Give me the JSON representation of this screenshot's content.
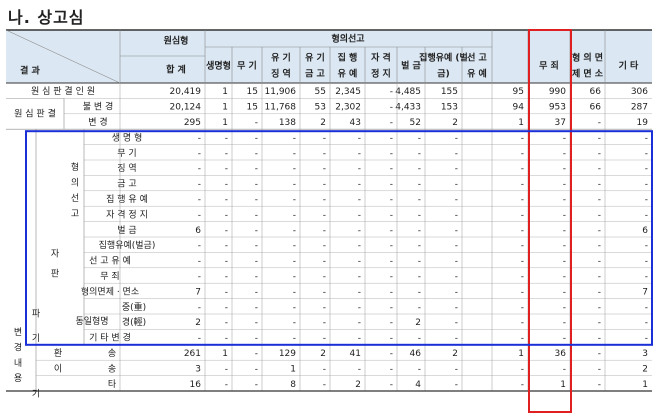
{
  "title": "나. 상고심",
  "header": {
    "result_label": "결 과",
    "original_sentence": "원심형",
    "total": "합 계",
    "sentence_group": "형의선고",
    "cols": [
      "생명형",
      "무 기",
      "유 기 징 역",
      "유 기 금 고",
      "집 행 유 예",
      "자 격 정 지",
      "벌 금",
      "집행유예 (벌 금)",
      "선 고 유 예",
      "무 죄",
      "형 의 면 제 면 소",
      "기 타"
    ]
  },
  "rows": [
    {
      "label": "원 심 판 결 인 원",
      "values": [
        "20,419",
        "1",
        "15",
        "11,906",
        "55",
        "2,345",
        "-",
        "4,485",
        "155",
        "95",
        "990",
        "66",
        "306"
      ]
    },
    {
      "label": "불 변 경",
      "values": [
        "20,124",
        "1",
        "15",
        "11,768",
        "53",
        "2,302",
        "-",
        "4,433",
        "153",
        "94",
        "953",
        "66",
        "287"
      ]
    },
    {
      "label": "변 경",
      "values": [
        "295",
        "1",
        "-",
        "138",
        "2",
        "43",
        "-",
        "52",
        "2",
        "1",
        "37",
        "-",
        "19"
      ]
    },
    {
      "label": "생 명 형",
      "values": [
        "-",
        "-",
        "-",
        "-",
        "-",
        "-",
        "-",
        "-",
        "-",
        "-",
        "-",
        "-",
        "-"
      ]
    },
    {
      "label": "무 기",
      "values": [
        "-",
        "-",
        "-",
        "-",
        "-",
        "-",
        "-",
        "-",
        "-",
        "-",
        "-",
        "-",
        "-"
      ]
    },
    {
      "label": "징 역",
      "values": [
        "-",
        "-",
        "-",
        "-",
        "-",
        "-",
        "-",
        "-",
        "-",
        "-",
        "-",
        "-",
        "-"
      ]
    },
    {
      "label": "금 고",
      "values": [
        "-",
        "-",
        "-",
        "-",
        "-",
        "-",
        "-",
        "-",
        "-",
        "-",
        "-",
        "-",
        "-"
      ]
    },
    {
      "label": "집 행 유 예",
      "values": [
        "-",
        "-",
        "-",
        "-",
        "-",
        "-",
        "-",
        "-",
        "-",
        "-",
        "-",
        "-",
        "-"
      ]
    },
    {
      "label": "자 격 정 지",
      "values": [
        "-",
        "-",
        "-",
        "-",
        "-",
        "-",
        "-",
        "-",
        "-",
        "-",
        "-",
        "-",
        "-"
      ]
    },
    {
      "label": "벌 금",
      "values": [
        "6",
        "-",
        "-",
        "-",
        "-",
        "-",
        "-",
        "-",
        "-",
        "-",
        "-",
        "-",
        "6"
      ]
    },
    {
      "label": "집행유예(벌금)",
      "values": [
        "-",
        "-",
        "-",
        "-",
        "-",
        "-",
        "-",
        "-",
        "-",
        "-",
        "-",
        "-",
        "-"
      ]
    },
    {
      "label": "선 고 유 예",
      "values": [
        "-",
        "-",
        "-",
        "-",
        "-",
        "-",
        "-",
        "-",
        "-",
        "-",
        "-",
        "-",
        "-"
      ]
    },
    {
      "label": "무 죄",
      "values": [
        "-",
        "-",
        "-",
        "-",
        "-",
        "-",
        "-",
        "-",
        "-",
        "-",
        "-",
        "-",
        "-"
      ]
    },
    {
      "label": "형의면제 · 면소",
      "values": [
        "7",
        "-",
        "-",
        "-",
        "-",
        "-",
        "-",
        "-",
        "-",
        "-",
        "-",
        "-",
        "7"
      ]
    },
    {
      "label": "중(重)",
      "values": [
        "-",
        "-",
        "-",
        "-",
        "-",
        "-",
        "-",
        "-",
        "-",
        "-",
        "-",
        "-",
        "-"
      ]
    },
    {
      "label": "경(輕)",
      "values": [
        "2",
        "-",
        "-",
        "-",
        "-",
        "-",
        "-",
        "2",
        "-",
        "-",
        "-",
        "-",
        "-"
      ]
    },
    {
      "label": "기 타 변 경",
      "values": [
        "-",
        "-",
        "-",
        "-",
        "-",
        "-",
        "-",
        "-",
        "-",
        "-",
        "-",
        "-",
        "-"
      ]
    },
    {
      "label": "환 송",
      "values": [
        "261",
        "1",
        "-",
        "129",
        "2",
        "41",
        "-",
        "46",
        "2",
        "1",
        "36",
        "-",
        "3"
      ]
    },
    {
      "label": "이 송",
      "values": [
        "3",
        "-",
        "-",
        "1",
        "-",
        "-",
        "-",
        "-",
        "-",
        "-",
        "-",
        "-",
        "2"
      ]
    },
    {
      "label": "타",
      "values": [
        "16",
        "-",
        "-",
        "8",
        "-",
        "2",
        "-",
        "4",
        "-",
        "-",
        "1",
        "-",
        "1"
      ]
    }
  ],
  "groups": {
    "original_judgment": "원 심 판 결",
    "change_content": "변 경 내 용",
    "self_judgment": "자 판",
    "reversal": "파 기",
    "sentence_declared": "형 의 선 고",
    "same_sentence": "동일형명",
    "partial_label": "기"
  },
  "colors": {
    "header_bg": "#dbe7f2",
    "highlight_red": "#e02020",
    "highlight_blue": "#1a2fd6"
  }
}
